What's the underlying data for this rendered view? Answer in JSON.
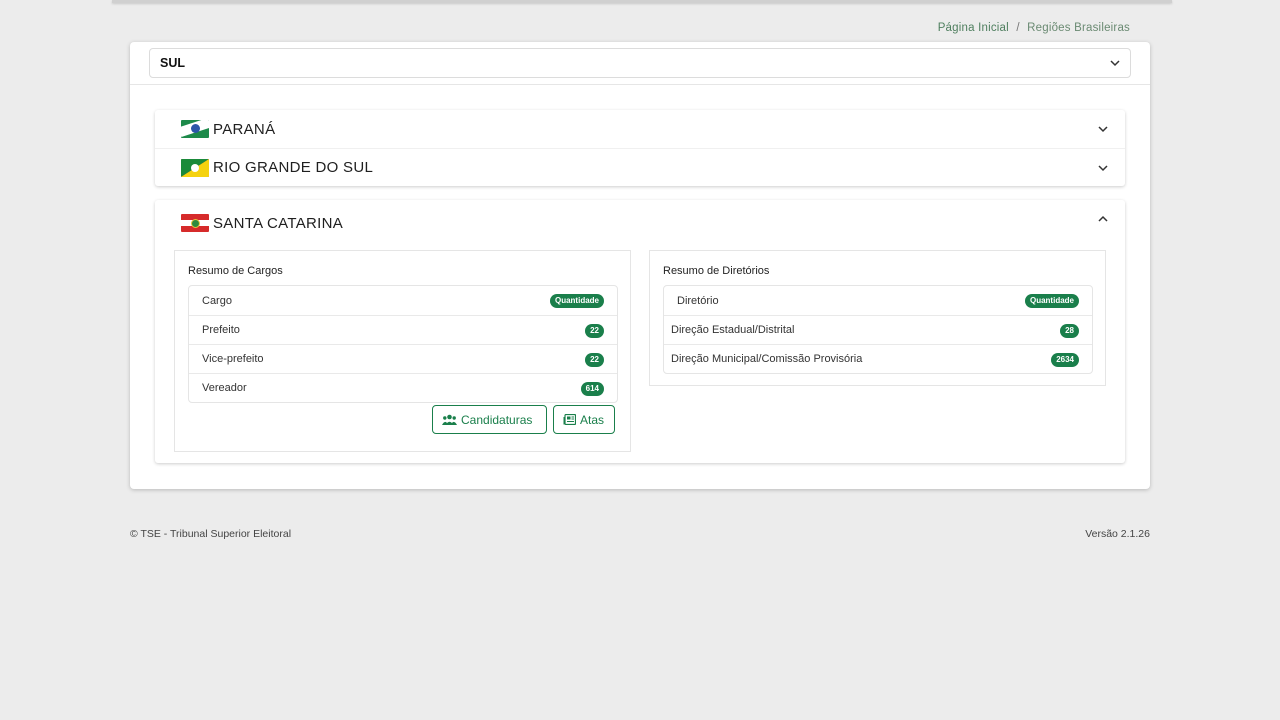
{
  "breadcrumb": {
    "home": "Página Inicial",
    "separator": "/",
    "current": "Regiões Brasileiras"
  },
  "region_select": {
    "value": "SUL"
  },
  "states": [
    {
      "name": "PARANÁ",
      "flag": "flag-parana-icon",
      "expanded": false
    },
    {
      "name": "RIO GRANDE DO SUL",
      "flag": "flag-rio-grande-do-sul-icon",
      "expanded": false
    },
    {
      "name": "SANTA CATARINA",
      "flag": "flag-santa-catarina-icon",
      "expanded": true
    }
  ],
  "cargos": {
    "title": "Resumo de Cargos",
    "header": {
      "label": "Cargo",
      "badge": "Quantidade"
    },
    "rows": [
      {
        "label": "Prefeito",
        "value": "22"
      },
      {
        "label": "Vice-prefeito",
        "value": "22"
      },
      {
        "label": "Vereador",
        "value": "614"
      }
    ]
  },
  "diretorios": {
    "title": "Resumo de Diretórios",
    "header": {
      "label": "Diretório",
      "badge": "Quantidade"
    },
    "rows": [
      {
        "label": "Direção Estadual/Distrital",
        "value": "28"
      },
      {
        "label": "Direção Municipal/Comissão Provisória",
        "value": "2634"
      }
    ]
  },
  "buttons": {
    "candidaturas": "Candidaturas",
    "atas": "Atas"
  },
  "footer": {
    "copyright": "© TSE - Tribunal Superior Eleitoral",
    "version": "Versão 2.1.26"
  },
  "colors": {
    "accent": "#1a7f4b",
    "background": "#ececec"
  }
}
